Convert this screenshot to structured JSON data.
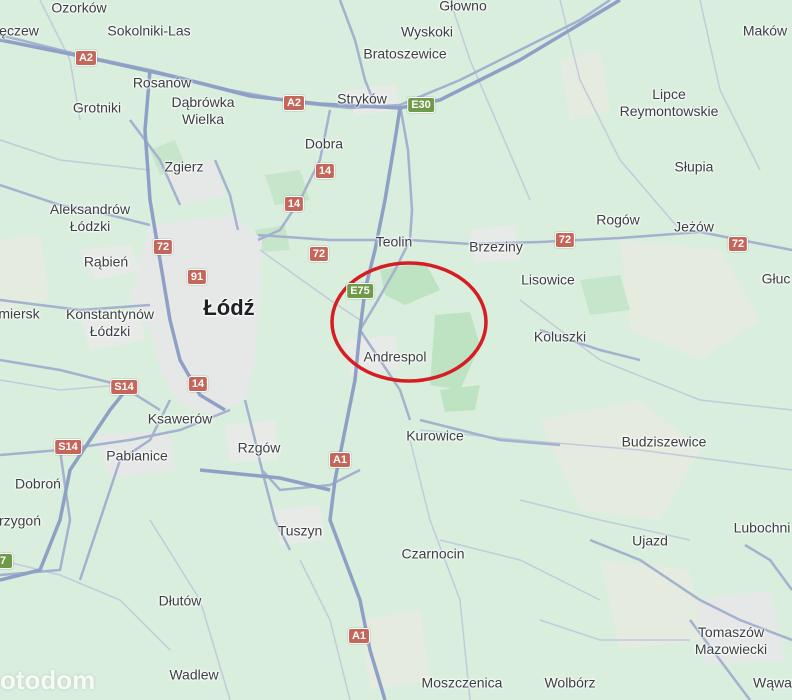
{
  "map": {
    "colors": {
      "background": "#d9eedd",
      "urban": "#e8eaea",
      "forest": "#b9e3c1",
      "field": "#e4ece0",
      "motorway": "#8f9fc4",
      "road": "#a5b1cd",
      "minor_road": "#c4cbdc",
      "highlight_circle": "#d51d23"
    },
    "places": [
      {
        "id": "ozorkow",
        "text": "Ozorków"
      },
      {
        "id": "sokolniki-las",
        "text": "Sokolniki-Las"
      },
      {
        "id": "leczew",
        "text": "ęczew"
      },
      {
        "id": "glowno",
        "text": "Głowno"
      },
      {
        "id": "wyskoki",
        "text": "Wyskoki"
      },
      {
        "id": "bratoszewice",
        "text": "Bratoszewice"
      },
      {
        "id": "makow",
        "text": "Maków"
      },
      {
        "id": "rosanow",
        "text": "Rosanów"
      },
      {
        "id": "grotniki",
        "text": "Grotniki"
      },
      {
        "id": "dabrowka-wielka",
        "text": "Dąbrówka\nWielka"
      },
      {
        "id": "strykow",
        "text": "Stryków"
      },
      {
        "id": "lipce-reymontowskie",
        "text": "Lipce\nReymontowskie"
      },
      {
        "id": "dobra",
        "text": "Dobra"
      },
      {
        "id": "zgierz",
        "text": "Zgierz"
      },
      {
        "id": "slupia",
        "text": "Słupia"
      },
      {
        "id": "aleksandrow-lodzki",
        "text": "Aleksandrów\nŁódzki"
      },
      {
        "id": "rogow",
        "text": "Rogów"
      },
      {
        "id": "jezow",
        "text": "Jeżów"
      },
      {
        "id": "teolin",
        "text": "Teolin"
      },
      {
        "id": "brzeziny",
        "text": "Brzeziny"
      },
      {
        "id": "rabien",
        "text": "Rąbień"
      },
      {
        "id": "glu",
        "text": "Głuc"
      },
      {
        "id": "lisowice",
        "text": "Lisowice"
      },
      {
        "id": "lodz",
        "text": "Łódź"
      },
      {
        "id": "zmiersk",
        "text": "miersk"
      },
      {
        "id": "konstantynow-lodzki",
        "text": "Konstantynów\nŁódzki"
      },
      {
        "id": "koluszki",
        "text": "Koluszki"
      },
      {
        "id": "andrespol",
        "text": "Andrespol"
      },
      {
        "id": "ksawerow",
        "text": "Ksawerów"
      },
      {
        "id": "kurowice",
        "text": "Kurowice"
      },
      {
        "id": "budziszewice",
        "text": "Budziszewice"
      },
      {
        "id": "rzgow",
        "text": "Rzgów"
      },
      {
        "id": "pabianice",
        "text": "Pabianice"
      },
      {
        "id": "dobron",
        "text": "Dobroń"
      },
      {
        "id": "lubochnia",
        "text": "Lubochni"
      },
      {
        "id": "zygon",
        "text": "rzygoń"
      },
      {
        "id": "tuszyn",
        "text": "Tuszyn"
      },
      {
        "id": "ujazd",
        "text": "Ujazd"
      },
      {
        "id": "czarnocin",
        "text": "Czarnocin"
      },
      {
        "id": "dlutow",
        "text": "Dłutów"
      },
      {
        "id": "tomaszow-mazowiecki",
        "text": "Tomaszów\nMazowiecki"
      },
      {
        "id": "wadlew",
        "text": "Wadlew"
      },
      {
        "id": "moszczenica",
        "text": "Moszczenica"
      },
      {
        "id": "wolborz",
        "text": "Wolbórz"
      },
      {
        "id": "wawal",
        "text": "Wąwal"
      }
    ],
    "road_shields": [
      {
        "id": "a2-west",
        "text": "A2",
        "color": "red"
      },
      {
        "id": "a2-east",
        "text": "A2",
        "color": "red"
      },
      {
        "id": "e30",
        "text": "E30",
        "color": "green"
      },
      {
        "id": "14-dobra",
        "text": "14",
        "color": "red"
      },
      {
        "id": "14-north",
        "text": "14",
        "color": "red"
      },
      {
        "id": "72-lodz",
        "text": "72",
        "color": "red"
      },
      {
        "id": "72-east",
        "text": "72",
        "color": "red"
      },
      {
        "id": "72-brzeziny",
        "text": "72",
        "color": "red"
      },
      {
        "id": "72-far-east",
        "text": "72",
        "color": "red"
      },
      {
        "id": "91",
        "text": "91",
        "color": "red"
      },
      {
        "id": "e75",
        "text": "E75",
        "color": "green"
      },
      {
        "id": "s14-north",
        "text": "S14",
        "color": "red"
      },
      {
        "id": "14-south",
        "text": "14",
        "color": "red"
      },
      {
        "id": "s14-south",
        "text": "S14",
        "color": "red"
      },
      {
        "id": "a1-north",
        "text": "A1",
        "color": "red"
      },
      {
        "id": "a1-south",
        "text": "A1",
        "color": "red"
      },
      {
        "id": "7-edge",
        "text": "7",
        "color": "green"
      }
    ],
    "watermark": "otodom"
  }
}
